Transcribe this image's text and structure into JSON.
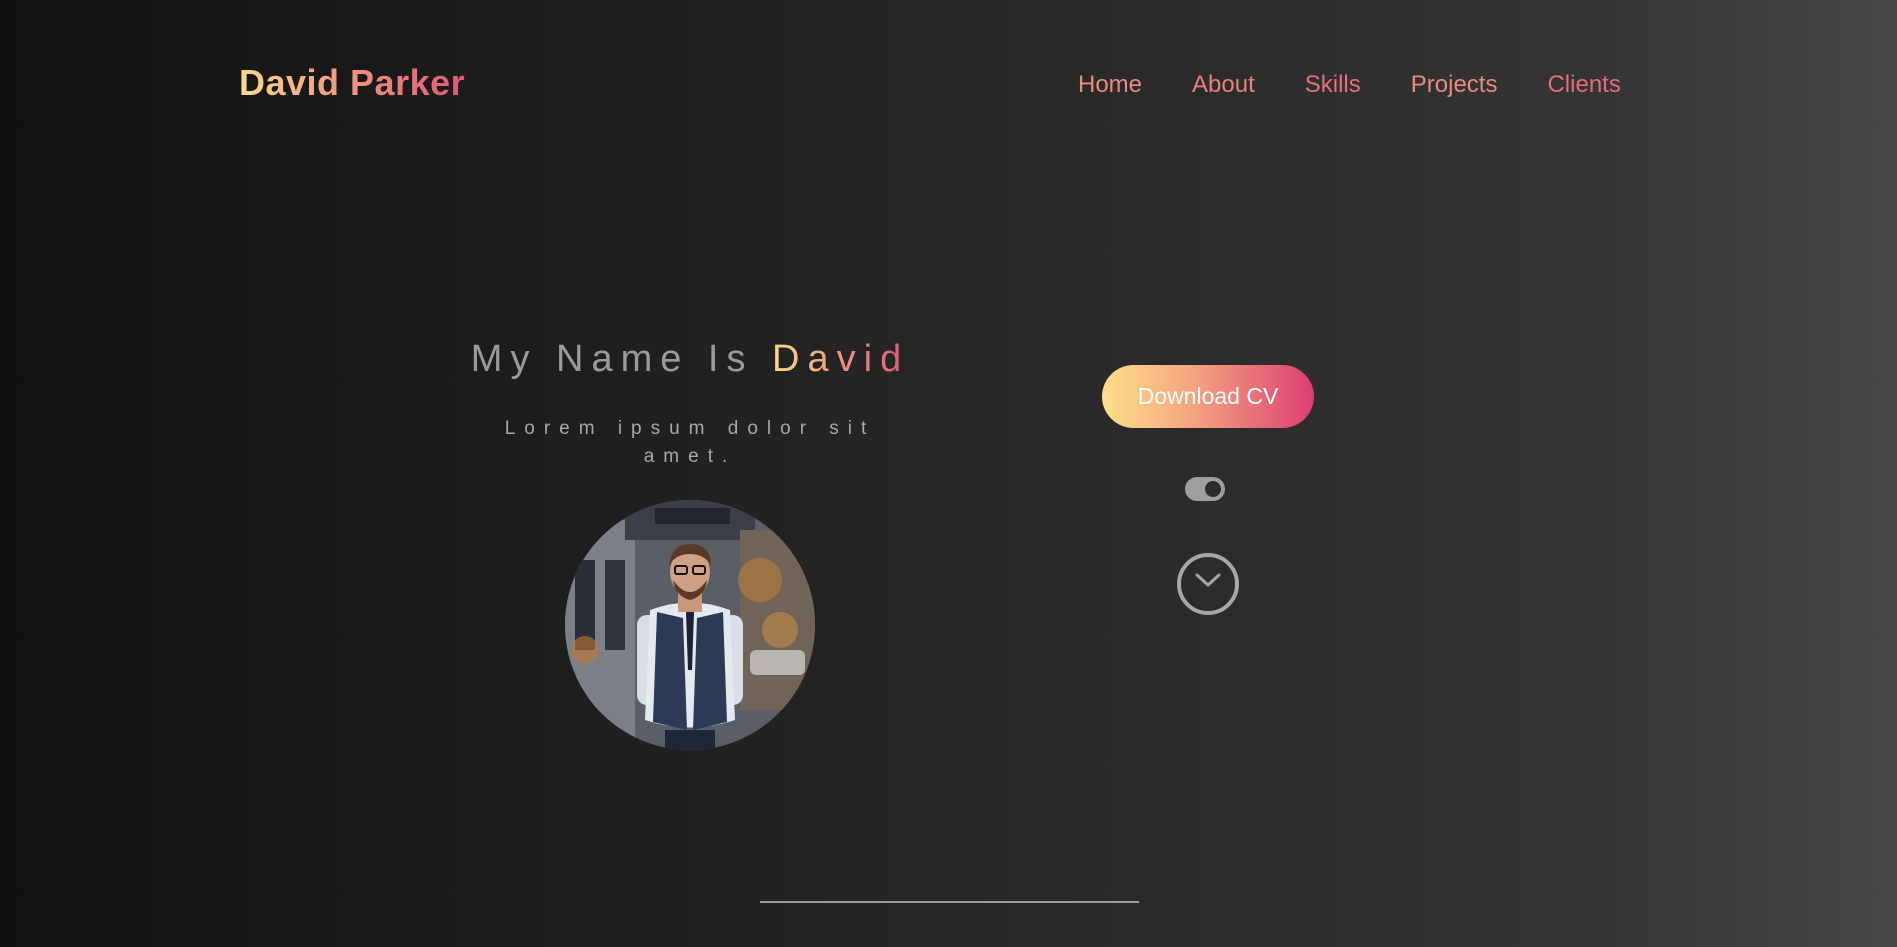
{
  "header": {
    "logo": "David Parker",
    "nav": [
      "Home",
      "About",
      "Skills",
      "Projects",
      "Clients"
    ]
  },
  "hero": {
    "title_prefix": "My Name Is ",
    "title_highlight": "David",
    "subtitle": "Lorem ipsum dolor sit amet.",
    "avatar_alt": "portrait-photo",
    "cv_button": "Download CV",
    "theme_toggle_on": true
  },
  "colors": {
    "gradient_start": "#fdd98a",
    "gradient_mid": "#f29a80",
    "gradient_end": "#e0557a",
    "background_dark": "#111111",
    "background_light": "#474747"
  },
  "icons": {
    "scroll": "chevron-down-icon",
    "toggle": "theme-toggle"
  }
}
